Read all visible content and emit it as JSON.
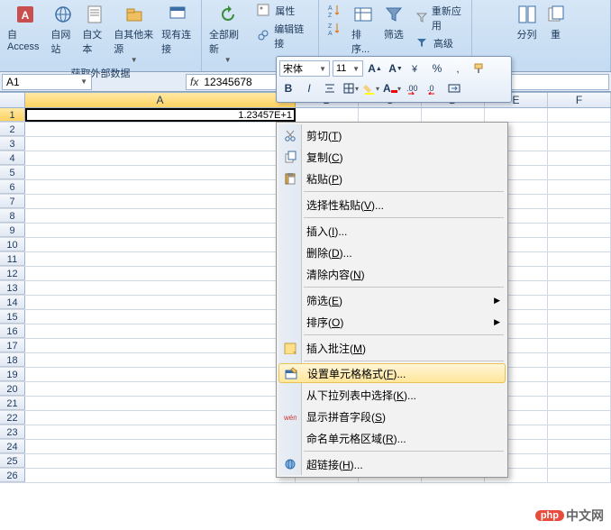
{
  "ribbon": {
    "group1": {
      "label": "获取外部数据",
      "access": "自 Access",
      "web": "自网站",
      "text": "自文本",
      "other": "自其他来源",
      "existing": "现有连接"
    },
    "group2": {
      "refresh": "全部刷新",
      "props": "属性",
      "editlinks": "编辑链接"
    },
    "group3": {
      "sort": "排序...",
      "filter": "筛选",
      "reapply": "重新应用",
      "advanced": "高级"
    },
    "group4": {
      "texttocol": "分列",
      "dup": "重"
    }
  },
  "namebox": {
    "ref": "A1"
  },
  "formula_bar": {
    "fx": "fx",
    "value": "12345678"
  },
  "columns": [
    "A",
    "B",
    "C",
    "D",
    "E",
    "F"
  ],
  "col_widths": {
    "A": 300,
    "B": 70,
    "C": 70,
    "D": 70,
    "E": 70,
    "F": 70
  },
  "cell_A1": "1.23457E+1",
  "row_count": 26,
  "mini_toolbar": {
    "font": "宋体",
    "size": "11",
    "percent": "%",
    "comma": ","
  },
  "context_menu": [
    {
      "label": "剪切",
      "hotkey": "T",
      "icon": "cut"
    },
    {
      "label": "复制",
      "hotkey": "C",
      "icon": "copy"
    },
    {
      "label": "粘贴",
      "hotkey": "P",
      "icon": "paste"
    },
    {
      "sep": true
    },
    {
      "label": "选择性粘贴",
      "hotkey": "V",
      "ell": true
    },
    {
      "sep": true
    },
    {
      "label": "插入",
      "hotkey": "I",
      "ell": true
    },
    {
      "label": "删除",
      "hotkey": "D",
      "ell": true
    },
    {
      "label": "清除内容",
      "hotkey": "N"
    },
    {
      "sep": true
    },
    {
      "label": "筛选",
      "hotkey": "E",
      "sub": true
    },
    {
      "label": "排序",
      "hotkey": "O",
      "sub": true
    },
    {
      "sep": true
    },
    {
      "label": "插入批注",
      "hotkey": "M",
      "icon": "comment"
    },
    {
      "sep": true
    },
    {
      "label": "设置单元格格式",
      "hotkey": "F",
      "ell": true,
      "icon": "format",
      "hover": true
    },
    {
      "label": "从下拉列表中选择",
      "hotkey": "K",
      "ell": true
    },
    {
      "label": "显示拼音字段",
      "hotkey": "S",
      "icon": "pinyin"
    },
    {
      "label": "命名单元格区域",
      "hotkey": "R",
      "ell": true
    },
    {
      "sep": true
    },
    {
      "label": "超链接",
      "hotkey": "H",
      "ell": true,
      "icon": "link"
    }
  ],
  "watermark": {
    "badge": "php",
    "text": "中文网"
  }
}
